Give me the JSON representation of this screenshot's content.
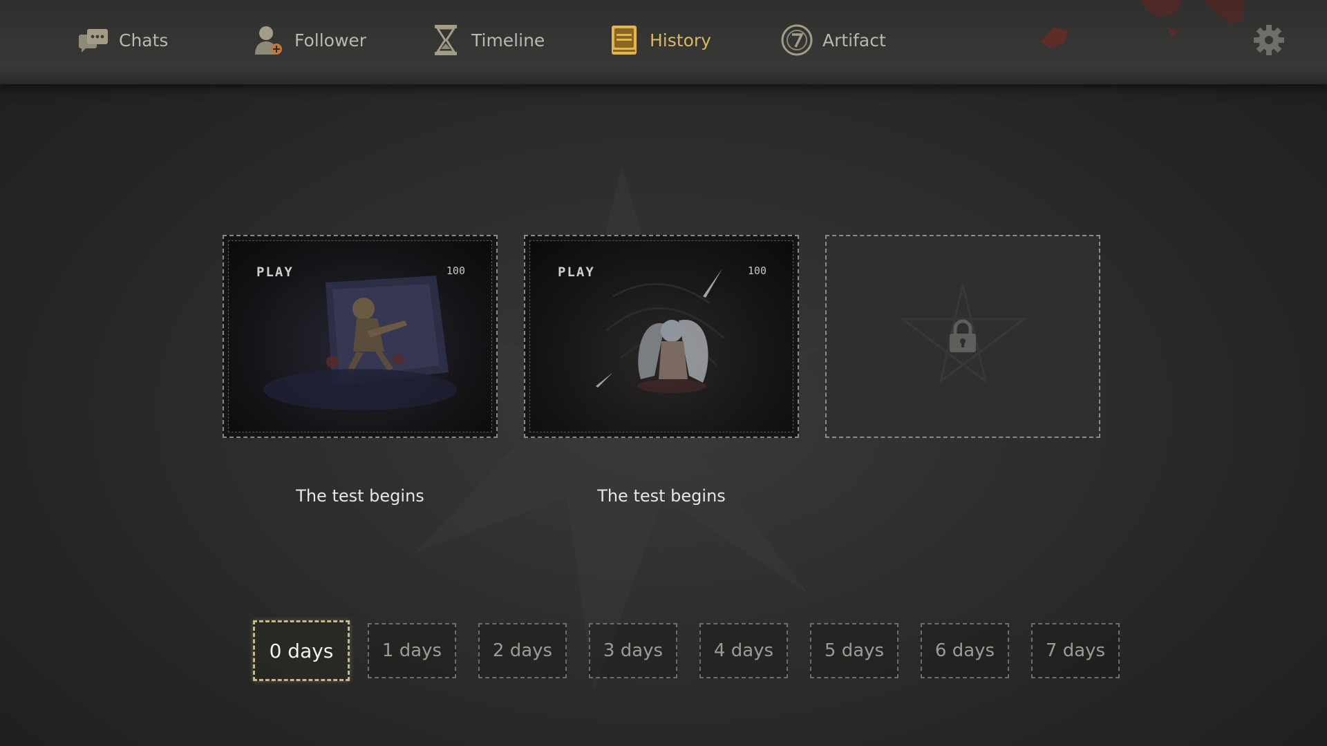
{
  "nav": {
    "items": [
      {
        "label": "Chats",
        "icon": "chat-icon"
      },
      {
        "label": "Follower",
        "icon": "follower-icon"
      },
      {
        "label": "Timeline",
        "icon": "hourglass-icon"
      },
      {
        "label": "History",
        "icon": "book-icon",
        "active": true
      },
      {
        "label": "Artifact",
        "icon": "artifact-seven-icon"
      }
    ],
    "settings_icon": "gear-icon"
  },
  "colors": {
    "active_tab": "#d9b860",
    "inactive_tab": "#b8b8b0",
    "background": "#2c2d2b"
  },
  "cards": [
    {
      "play_label": "PLAY",
      "score": "100",
      "title": "The test begins",
      "locked": false
    },
    {
      "play_label": "PLAY",
      "score": "100",
      "title": "The test begins",
      "locked": false
    },
    {
      "locked": true,
      "icon": "lock-icon"
    }
  ],
  "days": {
    "options": [
      "0 days",
      "1 days",
      "2 days",
      "3 days",
      "4 days",
      "5 days",
      "6 days",
      "7 days"
    ],
    "selected": "0 days"
  }
}
